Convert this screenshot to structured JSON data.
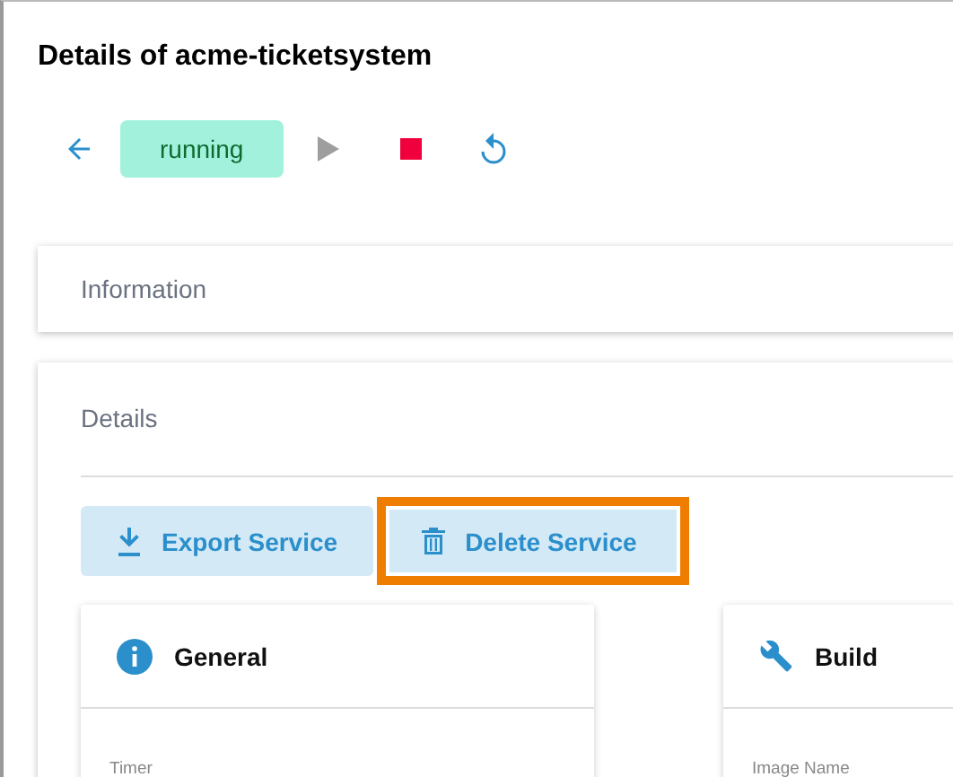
{
  "title": "Details of acme-ticketsystem",
  "toolbar": {
    "status": "running",
    "actions": [
      {
        "kind": "back",
        "disabled": false
      },
      {
        "kind": "start",
        "disabled": true
      },
      {
        "kind": "stop",
        "disabled": false
      },
      {
        "kind": "restart",
        "disabled": false
      }
    ]
  },
  "sections": [
    {
      "title": "Information"
    }
  ],
  "details": {
    "title": "Details",
    "buttons": [
      {
        "label": "Export Service",
        "kind": "export",
        "highlighted": false
      },
      {
        "label": "Delete Service",
        "kind": "delete",
        "highlighted": true
      }
    ],
    "cards": [
      {
        "title": "General",
        "kind": "info",
        "field_label": "Timer"
      },
      {
        "title": "Build",
        "kind": "build",
        "field_label": "Image Name"
      }
    ]
  }
}
